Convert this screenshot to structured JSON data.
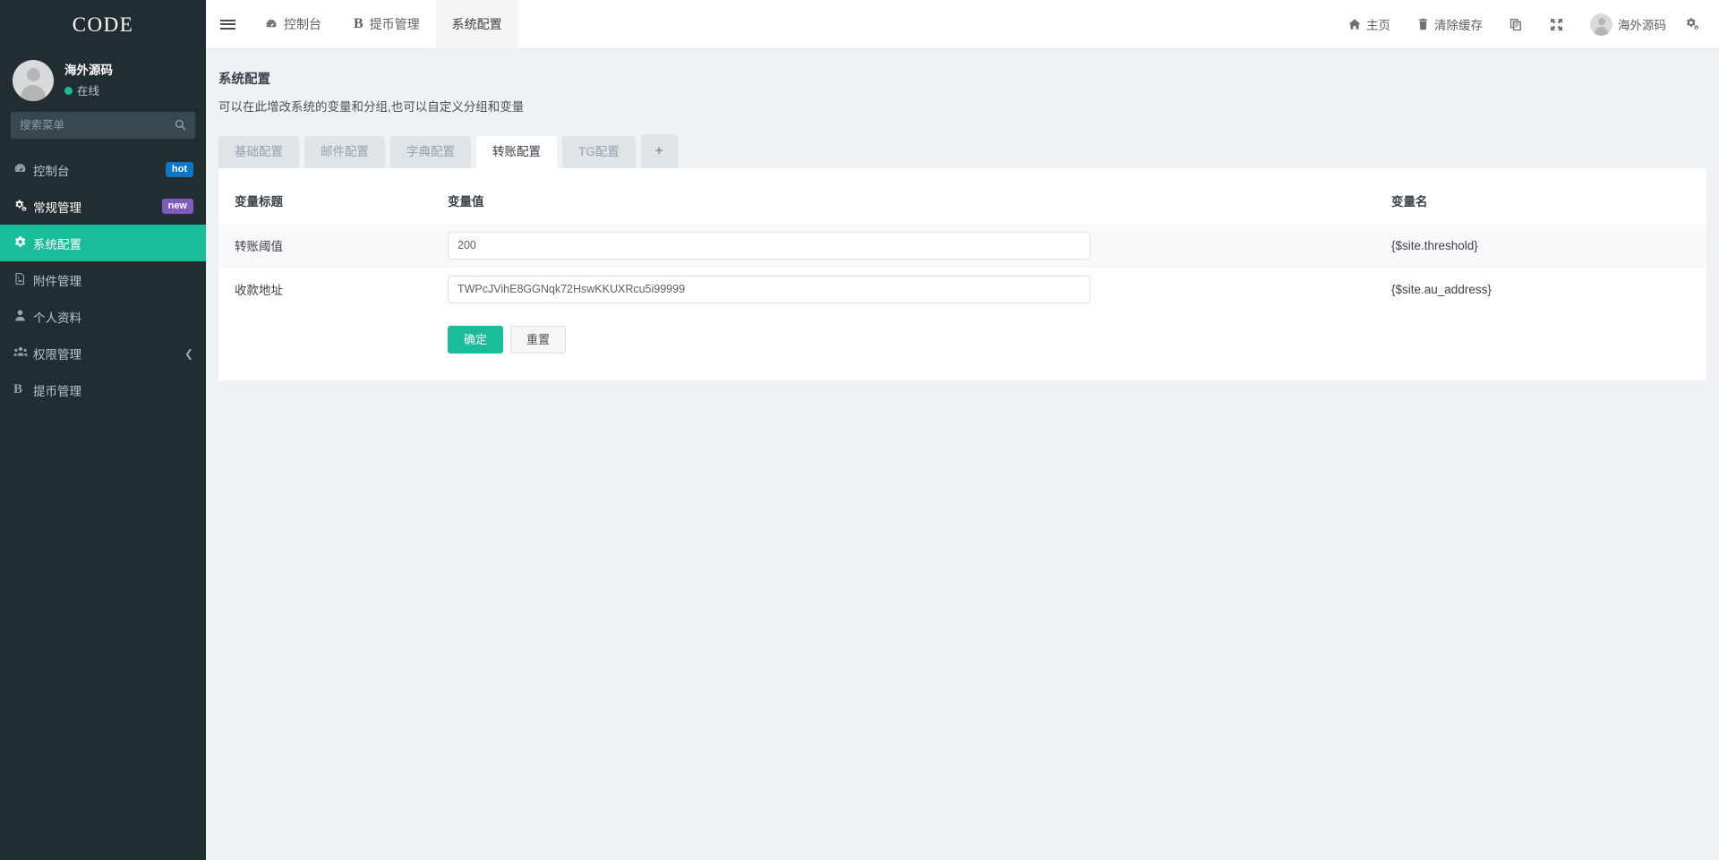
{
  "brand": {
    "title": "CODE"
  },
  "user": {
    "name": "海外源码",
    "status": "在线"
  },
  "search": {
    "placeholder": "搜索菜单",
    "value": "",
    "icon": "search-icon"
  },
  "sidebar": {
    "items": [
      {
        "label": "控制台",
        "icon": "dashboard-icon",
        "badge": "hot",
        "badge_type": "hot",
        "active": false
      },
      {
        "label": "常规管理",
        "icon": "cogs-icon",
        "badge": "new",
        "badge_type": "new",
        "active": false
      },
      {
        "label": "系统配置",
        "icon": "gear-icon",
        "badge": "",
        "badge_type": "",
        "active": true
      },
      {
        "label": "附件管理",
        "icon": "file-image-icon",
        "badge": "",
        "badge_type": "",
        "active": false
      },
      {
        "label": "个人资料",
        "icon": "user-icon",
        "badge": "",
        "badge_type": "",
        "active": false
      },
      {
        "label": "权限管理",
        "icon": "users-icon",
        "badge": "",
        "badge_type": "",
        "active": false
      },
      {
        "label": "提币管理",
        "icon": "bitcoin-icon",
        "badge": "",
        "badge_type": "",
        "active": false
      }
    ]
  },
  "topbar": {
    "menu_toggle": "hamburger-icon",
    "tabs": [
      {
        "label": "控制台",
        "icon": "dashboard-icon",
        "active": false
      },
      {
        "label": "提币管理",
        "icon": "bitcoin-icon",
        "active": false
      },
      {
        "label": "系统配置",
        "icon": "",
        "active": true
      }
    ],
    "right": [
      {
        "label": "主页",
        "icon": "home-icon"
      },
      {
        "label": "清除缓存",
        "icon": "trash-icon"
      },
      {
        "label": "",
        "icon": "theme-switch-icon"
      },
      {
        "label": "",
        "icon": "fullscreen-icon"
      }
    ],
    "account_name": "海外源码",
    "settings_icon": "gears-icon"
  },
  "page": {
    "title": "系统配置",
    "subtitle": "可以在此增改系统的变量和分组,也可以自定义分组和变量"
  },
  "config_tabs": [
    {
      "label": "基础配置",
      "active": false
    },
    {
      "label": "邮件配置",
      "active": false
    },
    {
      "label": "字典配置",
      "active": false
    },
    {
      "label": "转账配置",
      "active": true
    },
    {
      "label": "TG配置",
      "active": false
    }
  ],
  "add_tab_label": "+",
  "table": {
    "headers": {
      "title": "变量标题",
      "value": "变量值",
      "name": "变量名"
    },
    "rows": [
      {
        "title": "转账阈值",
        "value": "200",
        "name": "{$site.threshold}"
      },
      {
        "title": "收款地址",
        "value": "TWPcJVihE8GGNqk72HswKKUXRcu5i99999",
        "name": "{$site.au_address}"
      }
    ]
  },
  "actions": {
    "submit": "确定",
    "reset": "重置"
  },
  "colors": {
    "accent": "#1abc9c",
    "sidebar_bg": "#222d32",
    "badge_hot": "#0d76c7",
    "badge_new": "#7f5bbd"
  }
}
